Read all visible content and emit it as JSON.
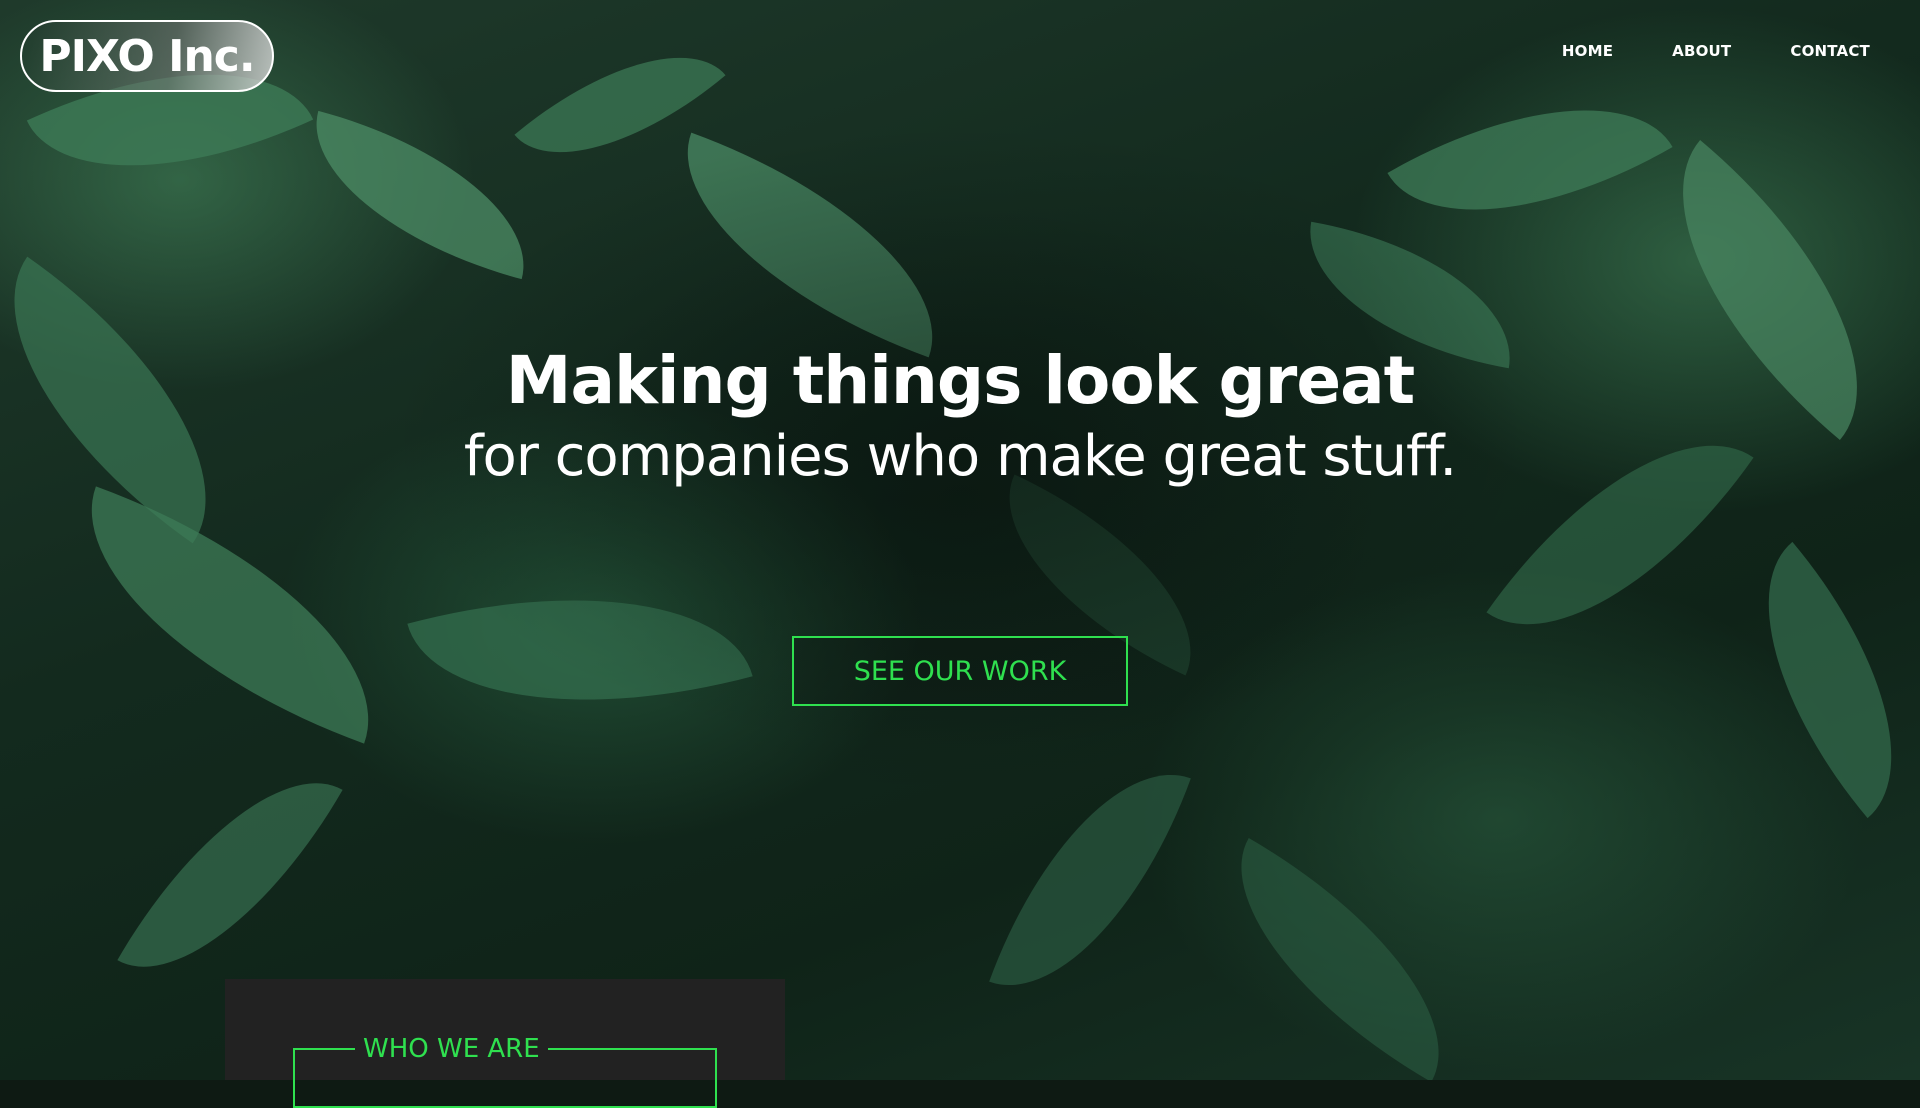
{
  "brand": {
    "logo_text": "PIXO Inc."
  },
  "nav": {
    "items": [
      {
        "label": "HOME"
      },
      {
        "label": "ABOUT"
      },
      {
        "label": "CONTACT"
      }
    ]
  },
  "hero": {
    "headline": "Making things look great",
    "subline": "for companies who make great stuff.",
    "cta_label": "SEE OUR WORK",
    "background_icon": "green-leaves-photo"
  },
  "section": {
    "title": "WHO WE ARE"
  },
  "colors": {
    "accent": "#2fe04f",
    "text": "#ffffff",
    "panel": "#222222"
  }
}
